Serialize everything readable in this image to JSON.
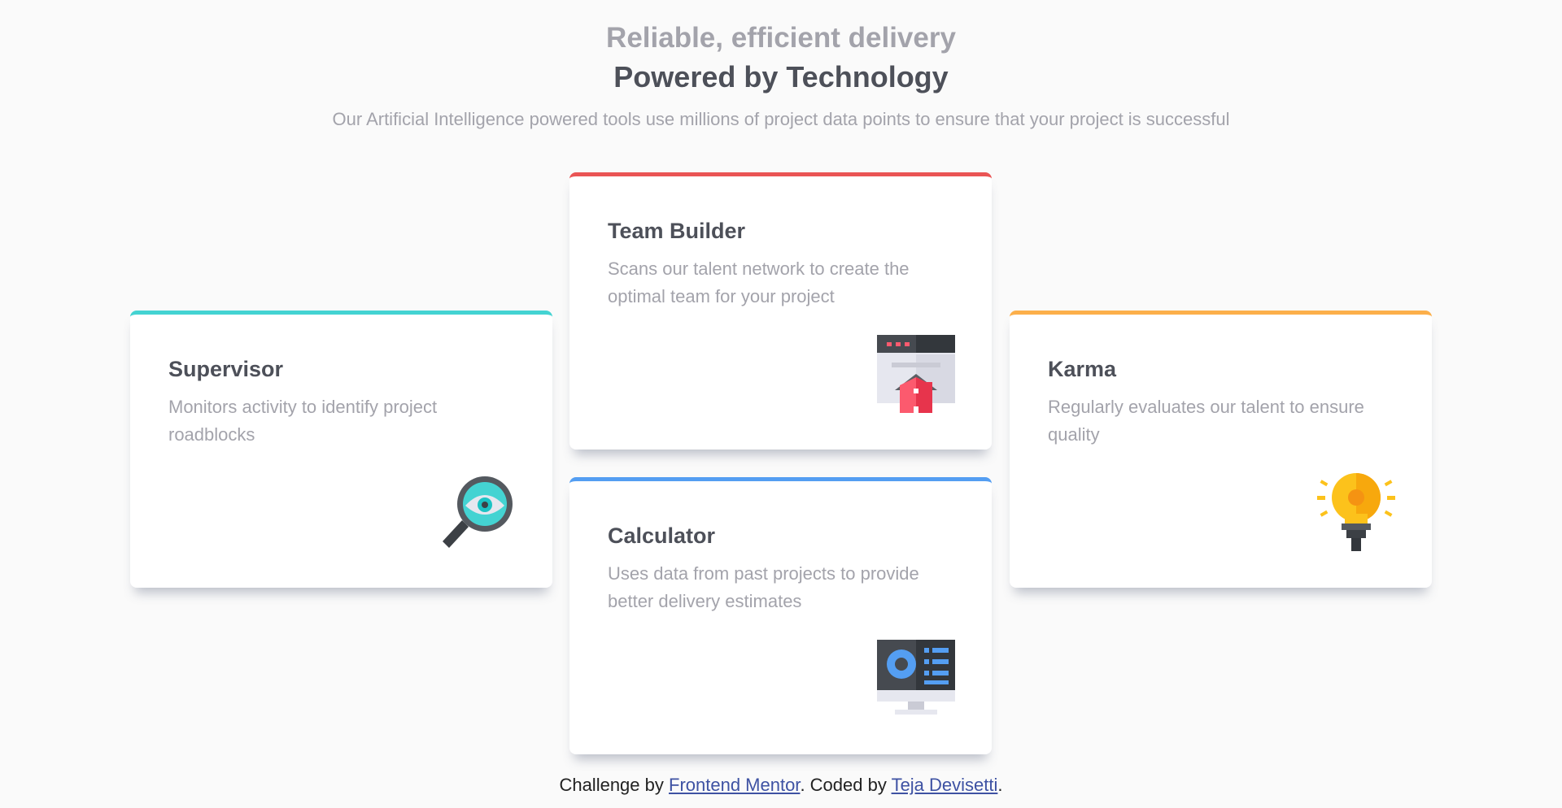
{
  "header": {
    "eyebrow": "Reliable, efficient delivery",
    "title": "Powered by Technology",
    "subtitle": "Our Artificial Intelligence powered tools use millions of project data points to ensure that your project is successful"
  },
  "cards": [
    {
      "title": "Supervisor",
      "desc": "Monitors activity to identify project roadblocks",
      "accent": "#44d3d2",
      "icon": "magnifier-eye-icon"
    },
    {
      "title": "Team Builder",
      "desc": "Scans our talent network to create the optimal team for your project",
      "accent": "#ea5454",
      "icon": "browser-house-icon"
    },
    {
      "title": "Karma",
      "desc": "Regularly evaluates our talent to ensure quality",
      "accent": "#fcaf4a",
      "icon": "lightbulb-icon"
    },
    {
      "title": "Calculator",
      "desc": "Uses data from past projects to provide better delivery estimates",
      "accent": "#549ef2",
      "icon": "monitor-icon"
    }
  ],
  "footer": {
    "prefix": "Challenge by ",
    "link1": "Frontend Mentor",
    "middle": ". Coded by ",
    "link2": "Teja Devisetti",
    "suffix": "."
  }
}
